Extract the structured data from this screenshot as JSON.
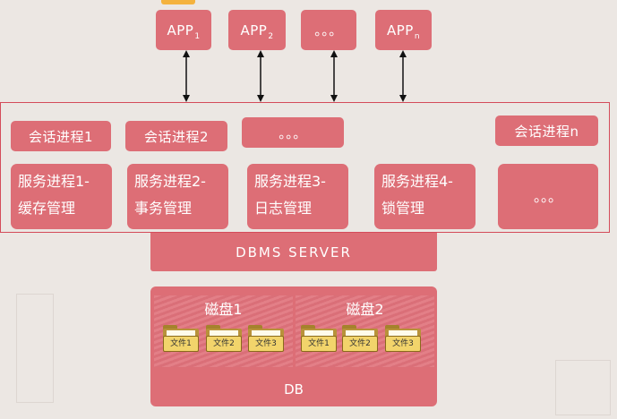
{
  "apps": [
    {
      "base": "APP",
      "sub": "1"
    },
    {
      "base": "APP",
      "sub": "2"
    },
    {
      "base": "。。。",
      "sub": ""
    },
    {
      "base": "APP",
      "sub": "n"
    }
  ],
  "sessions": [
    "会话进程1",
    "会话进程2",
    "。。。",
    "会话进程n"
  ],
  "services": [
    {
      "line1": "服务进程1-",
      "line2": "缓存管理"
    },
    {
      "line1": "服务进程2-",
      "line2": "事务管理"
    },
    {
      "line1": "服务进程3-",
      "line2": "日志管理"
    },
    {
      "line1": "服务进程4-",
      "line2": "锁管理"
    },
    {
      "line1": "。。。",
      "line2": ""
    }
  ],
  "server_label": "DBMS SERVER",
  "disks": [
    {
      "label": "磁盘1",
      "files": [
        "文件1",
        "文件2",
        "文件3"
      ]
    },
    {
      "label": "磁盘2",
      "files": [
        "文件1",
        "文件2",
        "文件3"
      ]
    }
  ],
  "db_label": "DB",
  "colors": {
    "block": "#dd6e76",
    "frame": "#d44c5a",
    "folder": "#f2d46b",
    "background": "#ece7e3"
  }
}
